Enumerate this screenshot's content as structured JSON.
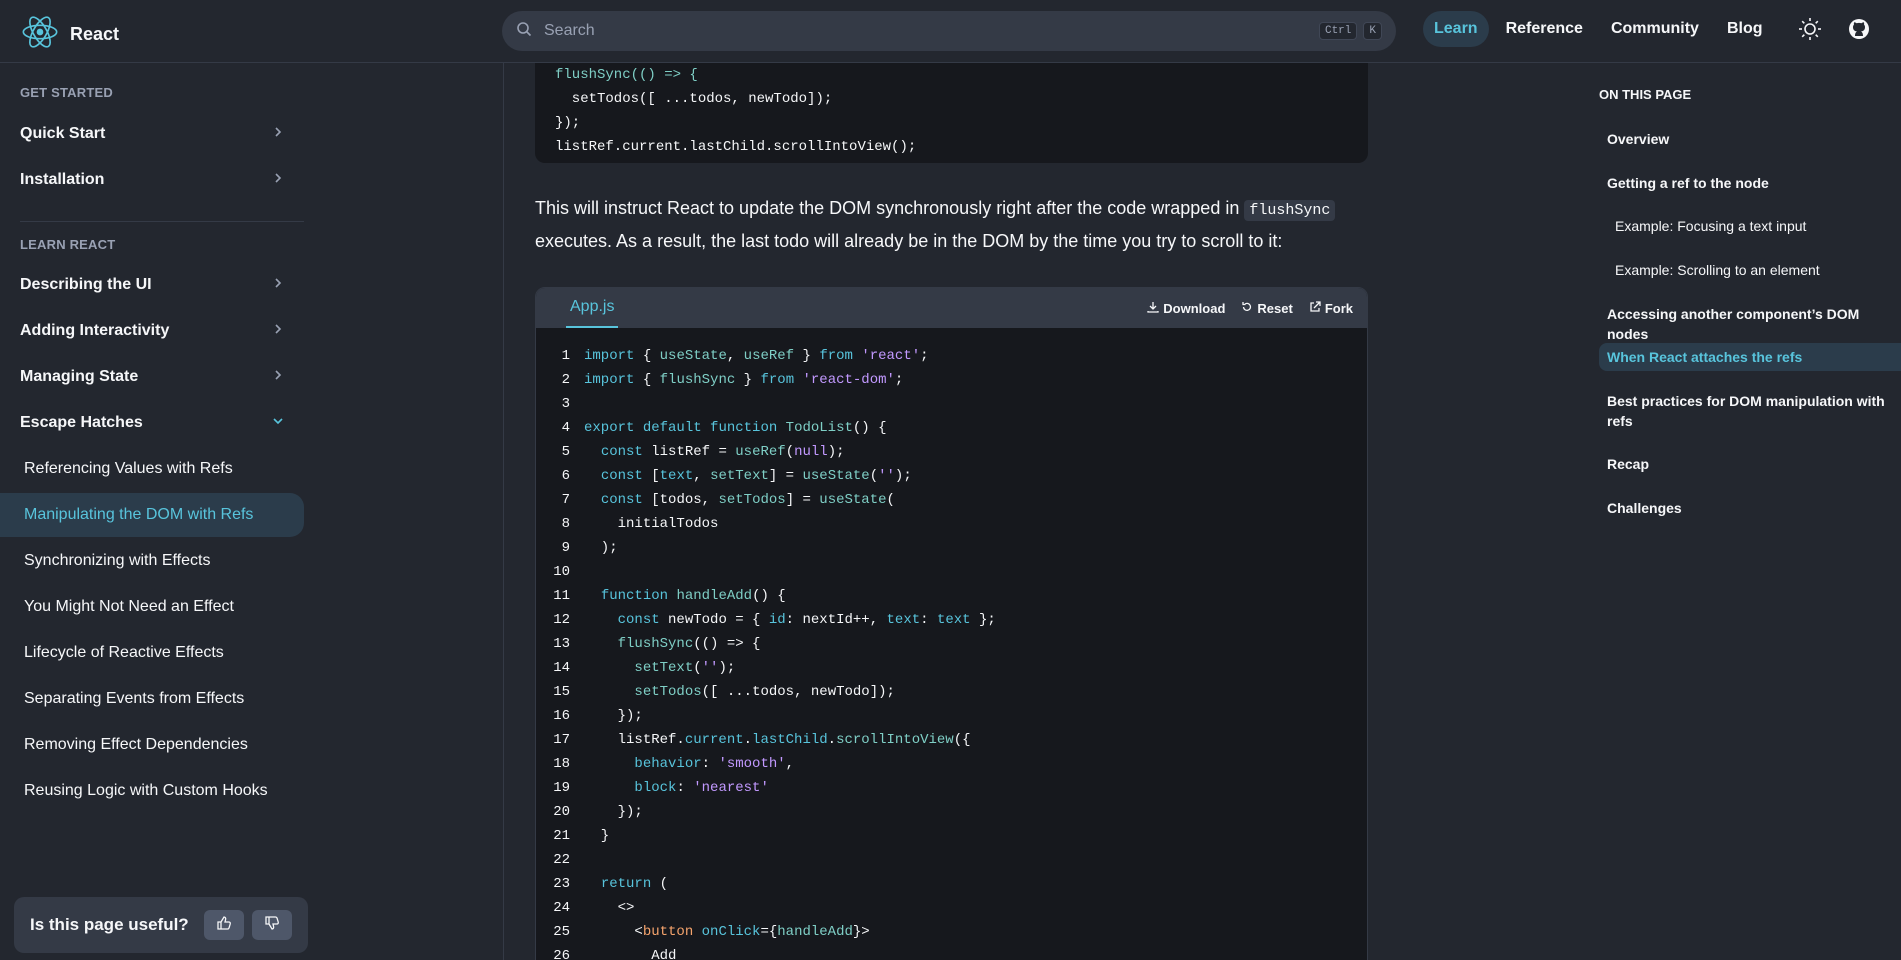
{
  "header": {
    "brand": "React",
    "search_placeholder": "Search",
    "shortcut_ctrl": "Ctrl",
    "shortcut_key": "K",
    "nav": [
      "Learn",
      "Reference",
      "Community",
      "Blog"
    ],
    "active_nav": "Learn",
    "icons": [
      "react-logo-icon",
      "search-icon",
      "theme-toggle-icon",
      "github-icon"
    ],
    "accent_color": "#58c4dc"
  },
  "sidebar": {
    "section_get_started": "GET STARTED",
    "get_started": [
      {
        "label": "Quick Start"
      },
      {
        "label": "Installation"
      }
    ],
    "section_learn": "LEARN REACT",
    "learn": [
      {
        "label": "Describing the UI"
      },
      {
        "label": "Adding Interactivity"
      },
      {
        "label": "Managing State"
      },
      {
        "label": "Escape Hatches"
      }
    ],
    "escape_hatches": [
      {
        "label": "Referencing Values with Refs"
      },
      {
        "label": "Manipulating the DOM with Refs"
      },
      {
        "label": "Synchronizing with Effects"
      },
      {
        "label": "You Might Not Need an Effect"
      },
      {
        "label": "Lifecycle of Reactive Effects"
      },
      {
        "label": "Separating Events from Effects"
      },
      {
        "label": "Removing Effect Dependencies"
      },
      {
        "label": "Reusing Logic with Custom Hooks"
      }
    ],
    "active_item": "Manipulating the DOM with Refs",
    "feedback_label": "Is this page useful?"
  },
  "main": {
    "top_code": [
      "flushSync(() => {",
      "  setTodos([ ...todos, newTodo]);",
      "});",
      "listRef.current.lastChild.scrollIntoView();"
    ],
    "paragraph_before": "This will instruct React to update the DOM synchronously right after the code wrapped in ",
    "paragraph_code": "flushSync",
    "paragraph_after": " executes. As a result, the last todo will already be in the DOM by the time you try to scroll to it:",
    "sandbox": {
      "tab": "App.js",
      "download": "Download",
      "reset": "Reset",
      "fork": "Fork"
    },
    "code_lines": [
      "import { useState, useRef } from 'react';",
      "import { flushSync } from 'react-dom';",
      "",
      "export default function TodoList() {",
      "  const listRef = useRef(null);",
      "  const [text, setText] = useState('');",
      "  const [todos, setTodos] = useState(",
      "    initialTodos",
      "  );",
      "",
      "  function handleAdd() {",
      "    const newTodo = { id: nextId++, text: text };",
      "    flushSync(() => {",
      "      setText('');",
      "      setTodos([ ...todos, newTodo]);",
      "    });",
      "    listRef.current.lastChild.scrollIntoView({",
      "      behavior: 'smooth',",
      "      block: 'nearest'",
      "    });",
      "  }",
      "",
      "  return (",
      "    <>",
      "      <button onClick={handleAdd}>",
      "        Add"
    ]
  },
  "toc": {
    "title": "ON THIS PAGE",
    "items": [
      {
        "label": "Overview",
        "level": 1
      },
      {
        "label": "Getting a ref to the node",
        "level": 1
      },
      {
        "label": "Example: Focusing a text input",
        "level": 2
      },
      {
        "label": "Example: Scrolling to an element",
        "level": 2
      },
      {
        "label": "Accessing another component’s DOM nodes",
        "level": 1
      },
      {
        "label": "When React attaches the refs",
        "level": 1
      },
      {
        "label": "Best practices for DOM manipulation with refs",
        "level": 1
      },
      {
        "label": "Recap",
        "level": 1
      },
      {
        "label": "Challenges",
        "level": 1
      }
    ],
    "active_item": "When React attaches the refs"
  }
}
